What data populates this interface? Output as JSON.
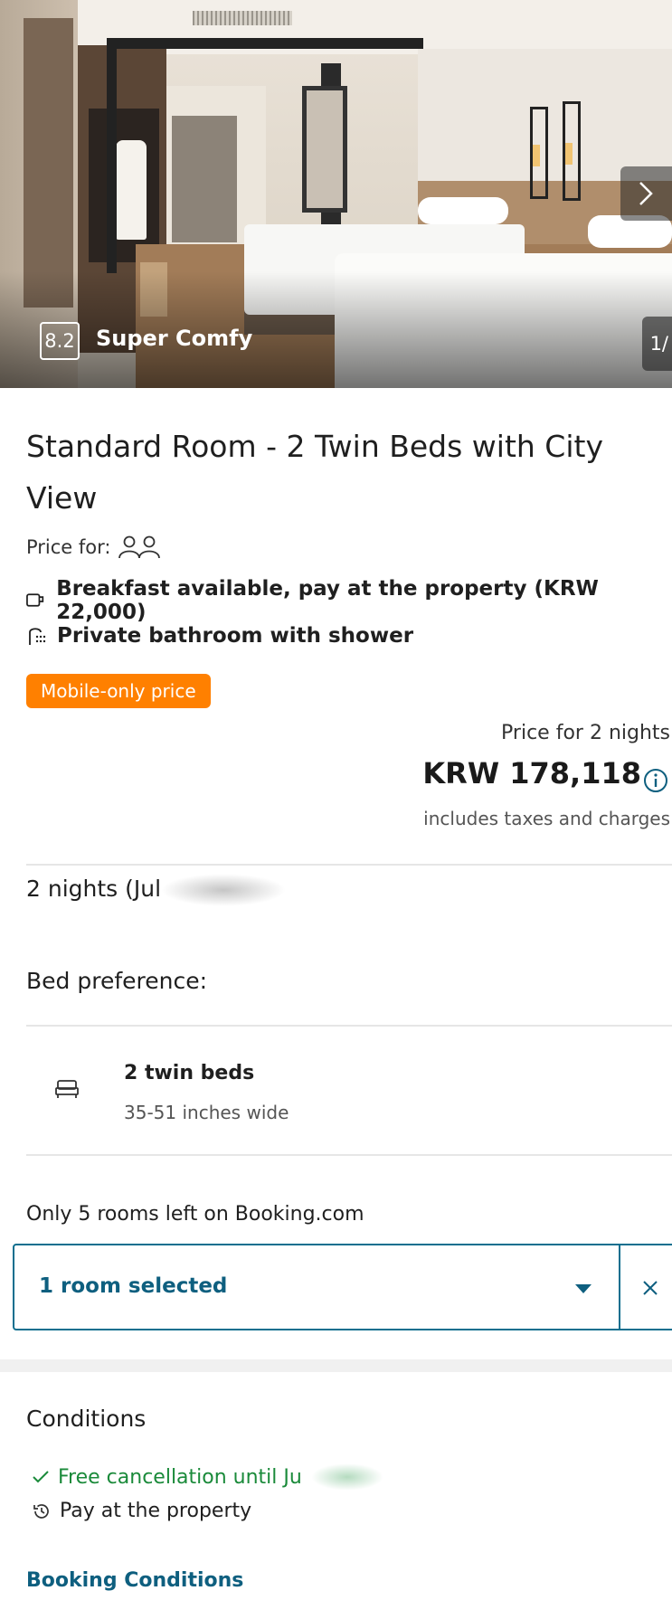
{
  "hero": {
    "rating_score": "8.2",
    "rating_label": "Super Comfy",
    "photo_counter": "1/"
  },
  "room": {
    "title": "Standard Room - 2 Twin Beds with City View",
    "price_for_label": "Price for:",
    "guest_icon": "two-person-icon",
    "facilities": [
      {
        "icon": "breakfast-cup-icon",
        "text": "Breakfast available, pay at the property (KRW 22,000)"
      },
      {
        "icon": "shower-icon",
        "text": "Private bathroom with shower"
      }
    ],
    "badge": "Mobile-only price",
    "badge_color": "#ff8000"
  },
  "pricing": {
    "nights_label": "Price for 2 nights",
    "price": "KRW 178,118",
    "taxes": "includes taxes and charges"
  },
  "stay": {
    "dates": "2 nights (Jul"
  },
  "beds": {
    "heading": "Bed preference:",
    "option_name": "2 twin beds",
    "option_detail": "35-51 inches wide"
  },
  "availability": {
    "note": "Only 5 rooms left on Booking.com",
    "selected": "1 room selected"
  },
  "conditions": {
    "heading": "Conditions",
    "free_cancellation": "Free cancellation until Ju",
    "pay_at_property": "Pay at the property",
    "link": "Booking Conditions",
    "accent_green": "#1a8a3a",
    "link_color": "#0e5f7f"
  }
}
